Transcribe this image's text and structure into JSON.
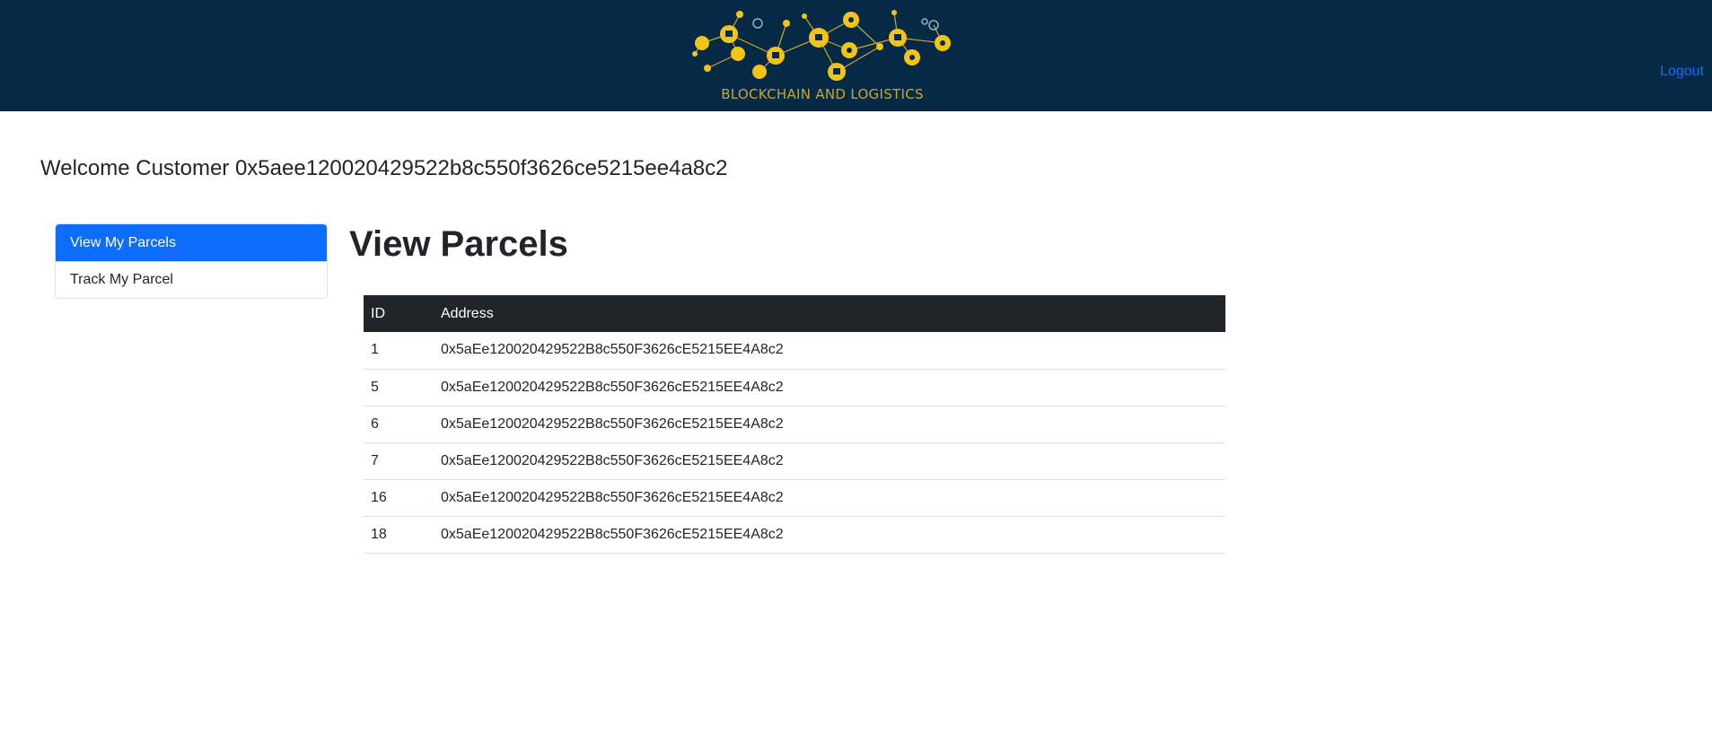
{
  "header": {
    "logo_text": "BLOCKCHAIN AND LOGISTICS",
    "logout_label": "Logout",
    "background_color": "#062a45",
    "logo_color": "#f2c418"
  },
  "welcome": {
    "text": "Welcome Customer 0x5aee120020429522b8c550f3626ce5215ee4a8c2"
  },
  "sidebar": {
    "items": [
      {
        "label": "View My Parcels",
        "active": true
      },
      {
        "label": "Track My Parcel",
        "active": false
      }
    ],
    "active_color": "#0d6efd"
  },
  "main": {
    "title": "View Parcels",
    "table": {
      "columns": [
        "ID",
        "Address"
      ],
      "rows": [
        {
          "id": "1",
          "address": "0x5aEe120020429522B8c550F3626cE5215EE4A8c2"
        },
        {
          "id": "5",
          "address": "0x5aEe120020429522B8c550F3626cE5215EE4A8c2"
        },
        {
          "id": "6",
          "address": "0x5aEe120020429522B8c550F3626cE5215EE4A8c2"
        },
        {
          "id": "7",
          "address": "0x5aEe120020429522B8c550F3626cE5215EE4A8c2"
        },
        {
          "id": "16",
          "address": "0x5aEe120020429522B8c550F3626cE5215EE4A8c2"
        },
        {
          "id": "18",
          "address": "0x5aEe120020429522B8c550F3626cE5215EE4A8c2"
        }
      ]
    }
  }
}
